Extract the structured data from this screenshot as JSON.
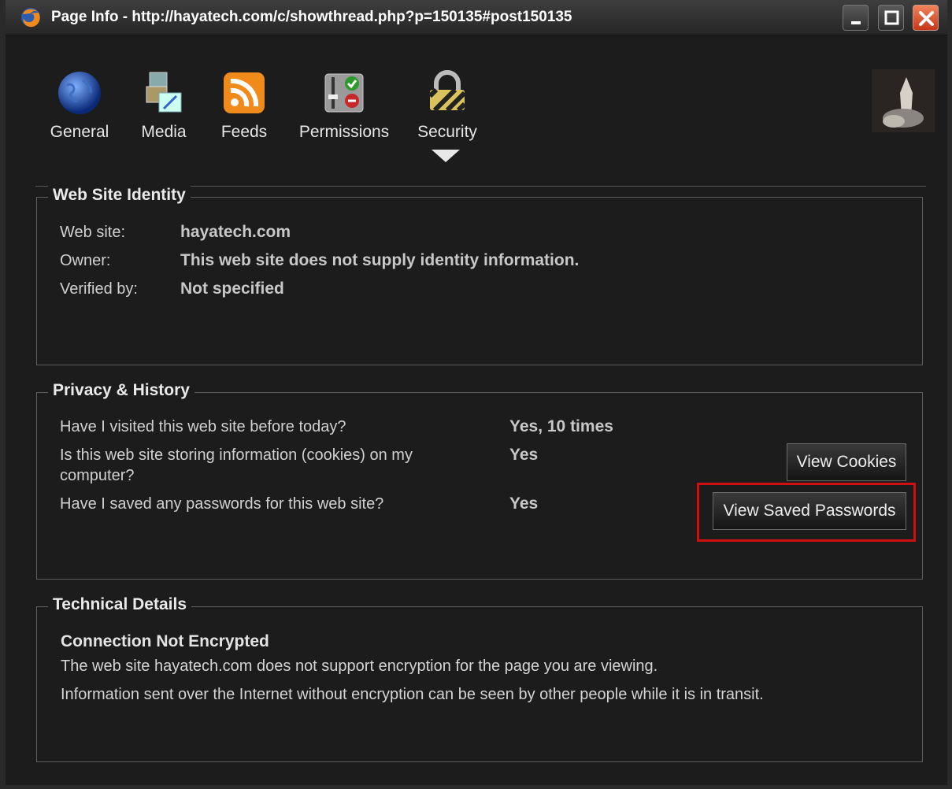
{
  "window": {
    "title": "Page Info - http://hayatech.com/c/showthread.php?p=150135#post150135"
  },
  "tabs": [
    {
      "label": "General",
      "icon": "globe-icon"
    },
    {
      "label": "Media",
      "icon": "media-icon"
    },
    {
      "label": "Feeds",
      "icon": "rss-icon"
    },
    {
      "label": "Permissions",
      "icon": "permissions-icon"
    },
    {
      "label": "Security",
      "icon": "padlock-icon",
      "selected": true
    }
  ],
  "identity": {
    "legend": "Web Site Identity",
    "website_label": "Web site:",
    "website_value": "hayatech.com",
    "owner_label": "Owner:",
    "owner_value": "This web site does not supply identity information.",
    "verified_label": "Verified by:",
    "verified_value": "Not specified"
  },
  "privacy": {
    "legend": "Privacy & History",
    "q1": "Have I visited this web site before today?",
    "a1": "Yes, 10 times",
    "q2_line1": "Is this web site storing information (cookies) on my",
    "q2_line2": "computer?",
    "a2": "Yes",
    "q3": "Have I saved any passwords for this web site?",
    "a3": "Yes",
    "view_cookies": "View Cookies",
    "view_passwords": "View Saved Passwords"
  },
  "technical": {
    "legend": "Technical Details",
    "heading": "Connection Not Encrypted",
    "line1": "The web site hayatech.com does not support encryption for the page you are viewing.",
    "line2": "Information sent over the Internet without encryption can be seen by other people while it is in transit."
  },
  "colors": {
    "highlight": "#d01010",
    "background": "#1c1c1c"
  }
}
